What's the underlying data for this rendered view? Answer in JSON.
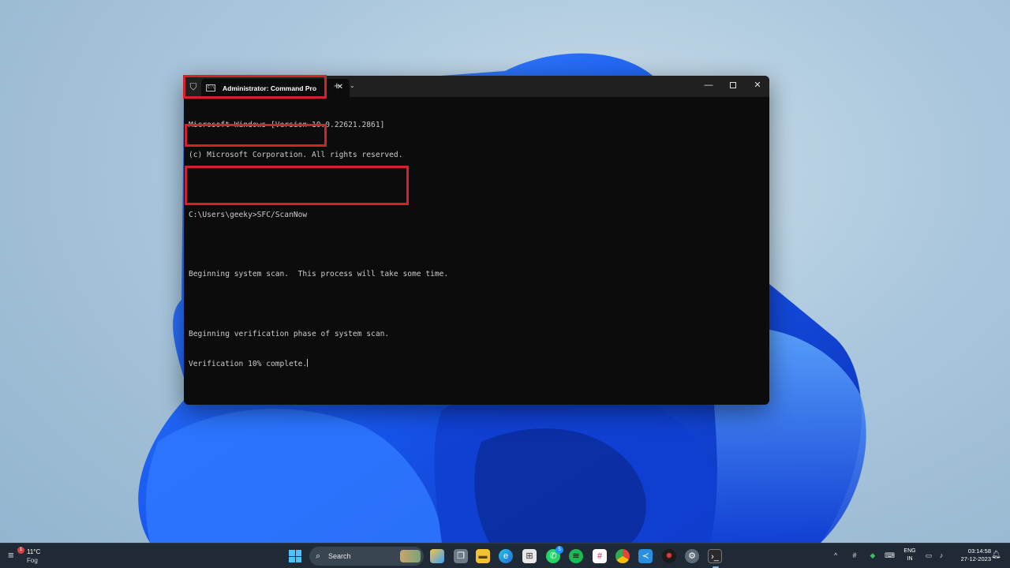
{
  "terminal": {
    "tab_title": "Administrator: Command Pro",
    "tab_close": "✕",
    "new_tab": "+",
    "dropdown": "⌄",
    "minimize": "—",
    "close": "✕",
    "lines": [
      "Microsoft Windows [Version 10.0.22621.2861]",
      "(c) Microsoft Corporation. All rights reserved.",
      "C:\\Users\\geeky>SFC/ScanNow",
      "Beginning system scan.  This process will take some time.",
      "Beginning verification phase of system scan.",
      "Verification 10% complete."
    ]
  },
  "taskbar": {
    "weather": {
      "temp": "11°C",
      "condition": "Fog",
      "badge": "1"
    },
    "search_label": "Search",
    "whatsapp_badge": "5",
    "tray": {
      "lang_top": "ENG",
      "lang_bottom": "IN"
    },
    "clock": {
      "time": "03:14:58",
      "date": "27-12-2023"
    }
  },
  "colors": {
    "highlight": "#d3232a",
    "console_bg": "#0c0c0c",
    "console_text": "#cccccc",
    "taskbar_bg": "#1f2a36"
  }
}
